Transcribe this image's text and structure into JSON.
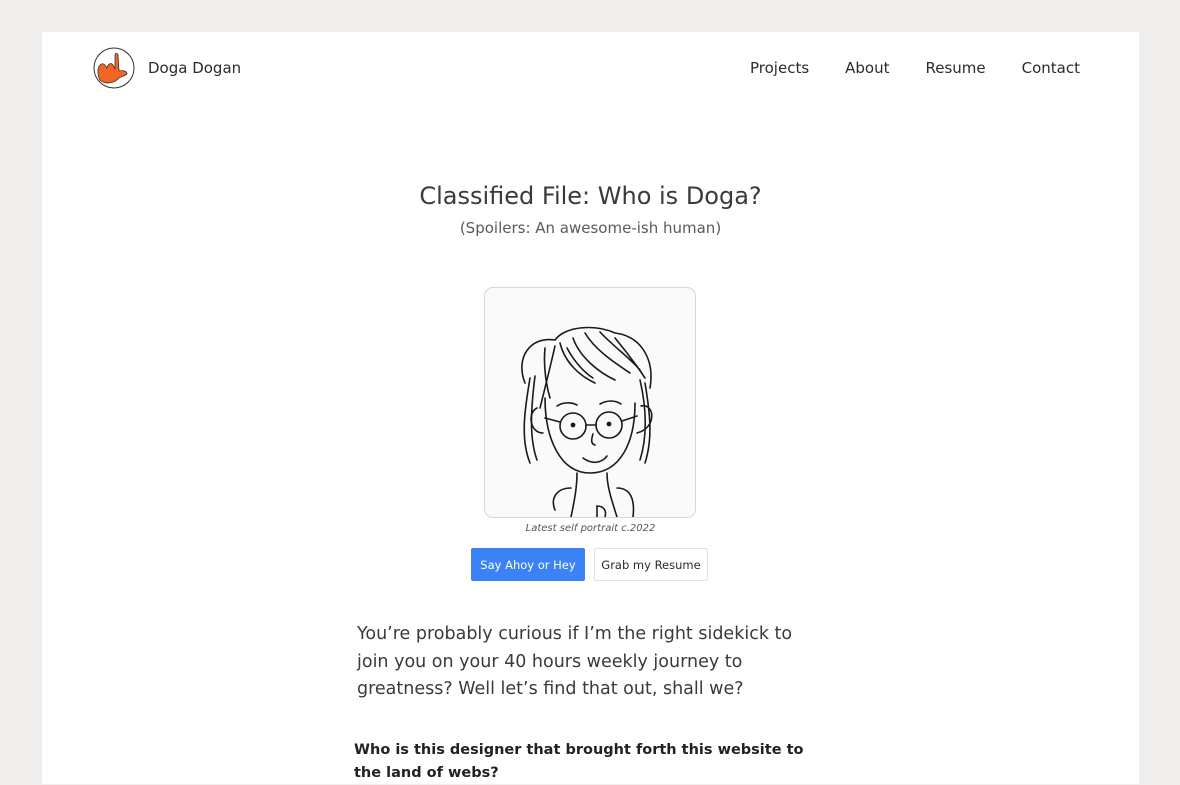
{
  "header": {
    "brand_name": "Doga Dogan",
    "logo_icon": "hand-gesture-logo-icon",
    "nav": [
      "Projects",
      "About",
      "Resume",
      "Contact"
    ]
  },
  "hero": {
    "title": "Classified File: Who is Doga?",
    "subtitle": "(Spoilers: An awesome-ish human)",
    "portrait_caption": "Latest self portrait c.2022"
  },
  "actions": {
    "primary_label": "Say Ahoy or Hey",
    "secondary_label": "Grab my Resume"
  },
  "body": {
    "intro": "You’re probably curious if I’m the right sidekick to join you on your 40 hours  weekly journey to greatness? Well let’s find that out, shall we?",
    "question": "Who is this designer that brought forth this website to the land of webs?"
  },
  "colors": {
    "accent": "#3b82f6",
    "logo_orange": "#f26522",
    "page_bg": "#ffffff",
    "outer_bg": "#efeeec"
  }
}
